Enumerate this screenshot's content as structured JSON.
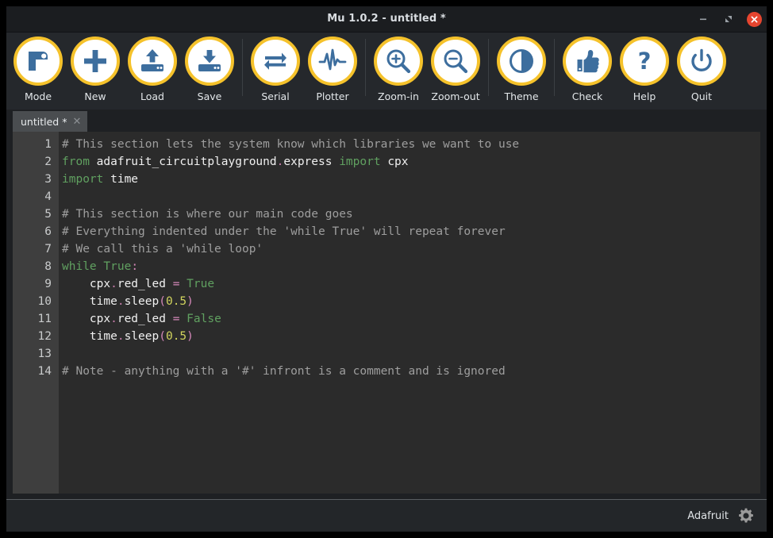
{
  "window": {
    "title": "Mu 1.0.2 - untitled *",
    "controls": {
      "minimize": "minimize-icon",
      "maximize": "maximize-icon",
      "close": "close-icon"
    }
  },
  "toolbar": {
    "items": [
      {
        "label": "Mode",
        "icon": "mode-icon"
      },
      {
        "label": "New",
        "icon": "plus-icon"
      },
      {
        "label": "Load",
        "icon": "upload-icon"
      },
      {
        "label": "Save",
        "icon": "download-icon"
      },
      {
        "label": "Serial",
        "icon": "swap-arrows-icon"
      },
      {
        "label": "Plotter",
        "icon": "waveform-icon"
      },
      {
        "label": "Zoom-in",
        "icon": "magnifier-plus-icon"
      },
      {
        "label": "Zoom-out",
        "icon": "magnifier-minus-icon"
      },
      {
        "label": "Theme",
        "icon": "contrast-circle-icon"
      },
      {
        "label": "Check",
        "icon": "thumbs-up-icon"
      },
      {
        "label": "Help",
        "icon": "question-mark-icon"
      },
      {
        "label": "Quit",
        "icon": "power-icon"
      }
    ],
    "separators_after": [
      3,
      5,
      7,
      8
    ],
    "accent_ring": "#f5c22b",
    "icon_color": "#3d6e9e"
  },
  "tabs": [
    {
      "label": "untitled *",
      "close": "✕",
      "active": true
    }
  ],
  "editor": {
    "line_numbers": [
      "1",
      "2",
      "3",
      "4",
      "5",
      "6",
      "7",
      "8",
      "9",
      "10",
      "11",
      "12",
      "13",
      "14"
    ],
    "lines": [
      {
        "n": 1,
        "tokens": [
          {
            "t": "comment",
            "s": "# This section lets the system know which libraries we want to use"
          }
        ]
      },
      {
        "n": 2,
        "tokens": [
          {
            "t": "kw",
            "s": "from"
          },
          {
            "t": "name",
            "s": " adafruit_circuitplayground"
          },
          {
            "t": "dot",
            "s": "."
          },
          {
            "t": "name",
            "s": "express "
          },
          {
            "t": "kw",
            "s": "import"
          },
          {
            "t": "name",
            "s": " cpx"
          }
        ]
      },
      {
        "n": 3,
        "tokens": [
          {
            "t": "kw",
            "s": "import"
          },
          {
            "t": "name",
            "s": " time"
          }
        ]
      },
      {
        "n": 4,
        "tokens": [
          {
            "t": "name",
            "s": ""
          }
        ]
      },
      {
        "n": 5,
        "tokens": [
          {
            "t": "comment",
            "s": "# This section is where our main code goes"
          }
        ]
      },
      {
        "n": 6,
        "tokens": [
          {
            "t": "comment",
            "s": "# Everything indented under the 'while True' will repeat forever"
          }
        ]
      },
      {
        "n": 7,
        "tokens": [
          {
            "t": "comment",
            "s": "# We call this a 'while loop'"
          }
        ]
      },
      {
        "n": 8,
        "tokens": [
          {
            "t": "kw",
            "s": "while"
          },
          {
            "t": "name",
            "s": " "
          },
          {
            "t": "builtin",
            "s": "True"
          },
          {
            "t": "op",
            "s": ":"
          }
        ]
      },
      {
        "n": 9,
        "tokens": [
          {
            "t": "name",
            "s": "    cpx"
          },
          {
            "t": "dot",
            "s": "."
          },
          {
            "t": "name",
            "s": "red_led "
          },
          {
            "t": "op",
            "s": "="
          },
          {
            "t": "name",
            "s": " "
          },
          {
            "t": "builtin",
            "s": "True"
          }
        ]
      },
      {
        "n": 10,
        "tokens": [
          {
            "t": "name",
            "s": "    time"
          },
          {
            "t": "dot",
            "s": "."
          },
          {
            "t": "name",
            "s": "sleep"
          },
          {
            "t": "punc",
            "s": "("
          },
          {
            "t": "num",
            "s": "0.5"
          },
          {
            "t": "punc",
            "s": ")"
          }
        ]
      },
      {
        "n": 11,
        "tokens": [
          {
            "t": "name",
            "s": "    cpx"
          },
          {
            "t": "dot",
            "s": "."
          },
          {
            "t": "name",
            "s": "red_led "
          },
          {
            "t": "op",
            "s": "="
          },
          {
            "t": "name",
            "s": " "
          },
          {
            "t": "builtin",
            "s": "False"
          }
        ]
      },
      {
        "n": 12,
        "tokens": [
          {
            "t": "name",
            "s": "    time"
          },
          {
            "t": "dot",
            "s": "."
          },
          {
            "t": "name",
            "s": "sleep"
          },
          {
            "t": "punc",
            "s": "("
          },
          {
            "t": "num",
            "s": "0.5"
          },
          {
            "t": "punc",
            "s": ")"
          }
        ]
      },
      {
        "n": 13,
        "tokens": [
          {
            "t": "name",
            "s": ""
          }
        ]
      },
      {
        "n": 14,
        "tokens": [
          {
            "t": "comment",
            "s": "# Note - anything with a '#' infront is a comment and is ignored"
          }
        ]
      }
    ],
    "plain_text": "# This section lets the system know which libraries we want to use\nfrom adafruit_circuitplayground.express import cpx\nimport time\n\n# This section is where our main code goes\n# Everything indented under the 'while True' will repeat forever\n# We call this a 'while loop'\nwhile True:\n    cpx.red_led = True\n    time.sleep(0.5)\n    cpx.red_led = False\n    time.sleep(0.5)\n\n# Note - anything with a '#' infront is a comment and is ignored",
    "colors": {
      "background": "#2b2b2b",
      "gutter": "#3e3e3e",
      "comment": "#9e9e9e",
      "keyword": "#60a060",
      "operator": "#d488b8",
      "number": "#d2d45e",
      "identifier": "#f0f0f0"
    }
  },
  "statusbar": {
    "mode": "Adafruit",
    "gear": "gear-icon"
  }
}
